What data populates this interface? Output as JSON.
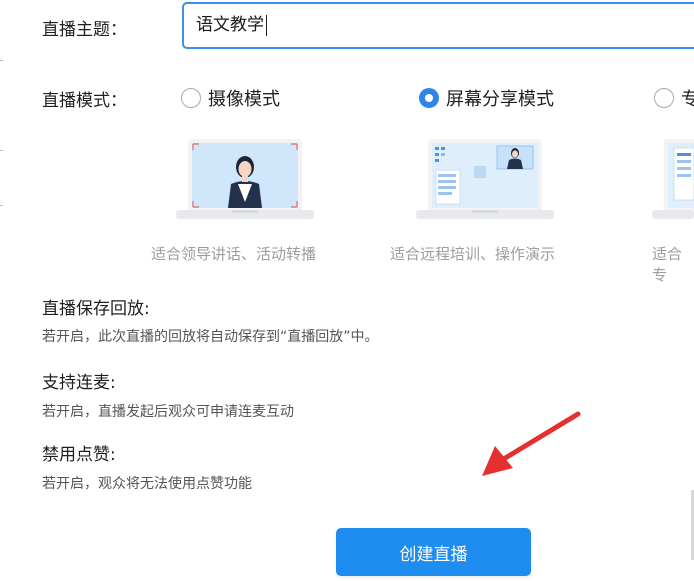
{
  "topic": {
    "label": "直播主题：",
    "value": "语文教学"
  },
  "mode": {
    "label": "直播模式：",
    "options": [
      {
        "label": "摄像模式",
        "caption": "适合领导讲话、活动转播",
        "selected": false
      },
      {
        "label": "屏幕分享模式",
        "caption": "适合远程培训、操作演示",
        "selected": true
      },
      {
        "label": "专",
        "caption": "适合专",
        "selected": false
      }
    ]
  },
  "settings": [
    {
      "title": "直播保存回放:",
      "desc": "若开启，此次直播的回放将自动保存到“直播回放”中。"
    },
    {
      "title": "支持连麦:",
      "desc": "若开启，直播发起后观众可申请连麦互动"
    },
    {
      "title": "禁用点赞:",
      "desc": "若开启，观众将无法使用点赞功能"
    }
  ],
  "create_button": "创建直播",
  "colors": {
    "accent": "#1f8cf0",
    "arrow": "#e53030"
  }
}
